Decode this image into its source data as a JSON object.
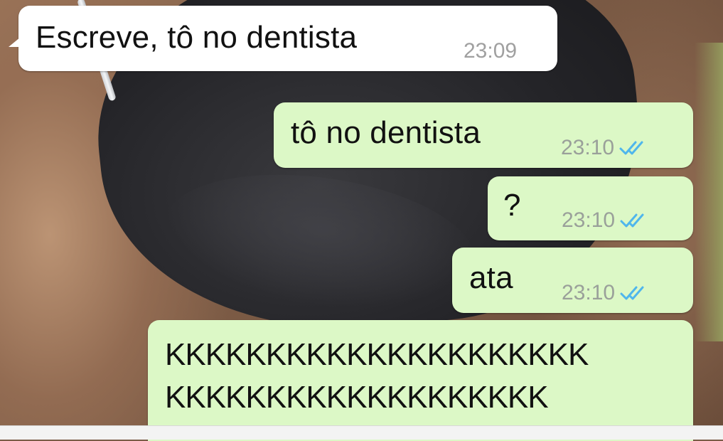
{
  "chat": {
    "messages": [
      {
        "direction": "incoming",
        "text": "Escreve, tô no dentista",
        "time": "23:09"
      },
      {
        "direction": "outgoing",
        "text": "tô no dentista",
        "time": "23:10",
        "status_icon": "double-check-read-icon"
      },
      {
        "direction": "outgoing",
        "text": "?",
        "time": "23:10",
        "status_icon": "double-check-read-icon"
      },
      {
        "direction": "outgoing",
        "text": "ata",
        "time": "23:10",
        "status_icon": "double-check-read-icon"
      },
      {
        "direction": "outgoing",
        "lines": [
          "KKKKKKKKKKKKKKKKKKKKK",
          "KKKKKKKKKKKKKKKKKKK"
        ]
      }
    ]
  },
  "colors": {
    "incoming_bubble": "#ffffff",
    "outgoing_bubble": "#dcf8c6",
    "read_ticks": "#4fb6ec",
    "timestamp": "#9aa09a"
  }
}
